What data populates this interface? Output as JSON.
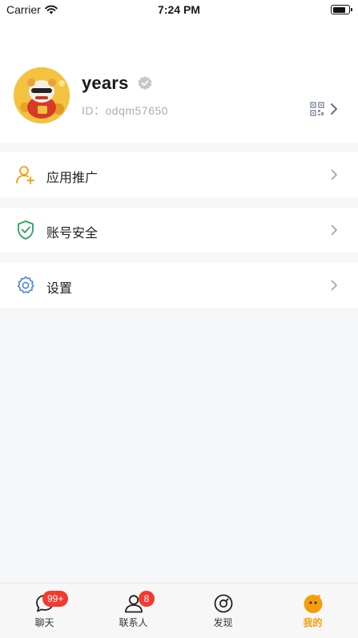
{
  "status_bar": {
    "carrier": "Carrier",
    "time": "7:24 PM"
  },
  "profile": {
    "username": "years",
    "user_id": "ID：odqm57650"
  },
  "menu": [
    {
      "label": "应用推广",
      "icon": "user-plus-icon"
    },
    {
      "label": "账号安全",
      "icon": "shield-check-icon"
    },
    {
      "label": "设置",
      "icon": "gear-icon"
    }
  ],
  "tabs": [
    {
      "label": "聊天",
      "badge": "99+",
      "icon": "chat-bubble-icon"
    },
    {
      "label": "联系人",
      "badge": "8",
      "icon": "contacts-icon"
    },
    {
      "label": "发现",
      "icon": "discover-icon"
    },
    {
      "label": "我的",
      "icon": "me-face-icon",
      "active": true
    }
  ],
  "colors": {
    "accent": "#f59d0c",
    "badge": "#f23b2f",
    "shield": "#27a35a",
    "gear": "#4a82e0"
  }
}
